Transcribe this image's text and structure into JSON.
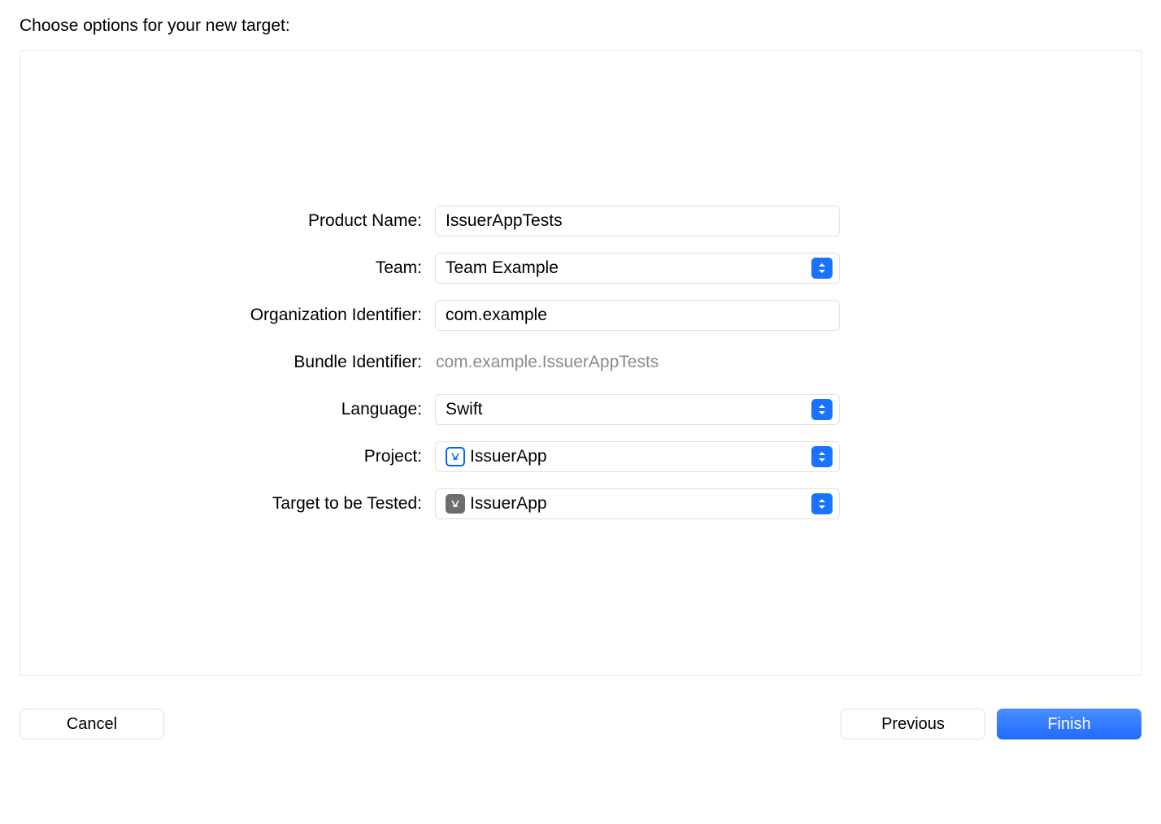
{
  "heading": "Choose options for your new target:",
  "form": {
    "productName": {
      "label": "Product Name:",
      "value": "IssuerAppTests"
    },
    "team": {
      "label": "Team:",
      "value": "Team Example"
    },
    "orgIdentifier": {
      "label": "Organization Identifier:",
      "value": "com.example"
    },
    "bundleIdentifier": {
      "label": "Bundle Identifier:",
      "value": "com.example.IssuerAppTests"
    },
    "language": {
      "label": "Language:",
      "value": "Swift"
    },
    "project": {
      "label": "Project:",
      "value": "IssuerApp"
    },
    "targetToTest": {
      "label": "Target to be Tested:",
      "value": "IssuerApp"
    }
  },
  "buttons": {
    "cancel": "Cancel",
    "previous": "Previous",
    "finish": "Finish"
  }
}
